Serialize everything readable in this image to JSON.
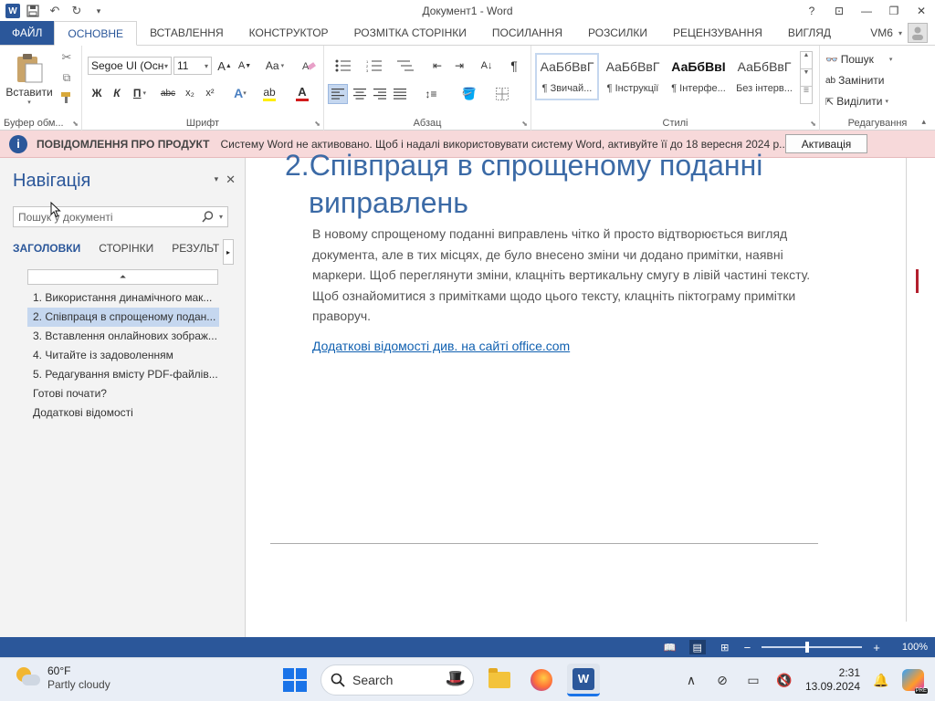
{
  "window": {
    "title": "Документ1 - Word",
    "help": "?",
    "controls": [
      "⊡",
      "—",
      "❐",
      "✕"
    ]
  },
  "quick_access": {
    "logo": "W",
    "icons": [
      "save-icon",
      "undo-icon",
      "redo-icon",
      "customize-icon"
    ]
  },
  "tabs": [
    "ФАЙЛ",
    "ОСНОВНЕ",
    "ВСТАВЛЕННЯ",
    "КОНСТРУКТОР",
    "РОЗМІТКА СТОРІНКИ",
    "ПОСИЛАННЯ",
    "РОЗСИЛКИ",
    "РЕЦЕНЗУВАННЯ",
    "ВИГЛЯД"
  ],
  "user": {
    "name": "VM6"
  },
  "ribbon": {
    "clipboard": {
      "paste_label": "Вставити",
      "group_label": "Буфер обм..."
    },
    "font": {
      "font_name": "Segoe UI (Осн",
      "font_size": "11",
      "grow": "A",
      "shrink": "A",
      "case": "Aa",
      "bold": "Ж",
      "italic": "К",
      "underline": "П",
      "strike": "abc",
      "subscript": "x₂",
      "superscript": "x²",
      "group_label": "Шрифт"
    },
    "paragraph": {
      "group_label": "Абзац",
      "pilcrow": "¶"
    },
    "styles": {
      "items": [
        {
          "sample": "АаБбВвГ",
          "name": "¶ Звичай..."
        },
        {
          "sample": "АаБбВвГ",
          "name": "¶ Інструкції"
        },
        {
          "sample": "АаБбВвІ",
          "name": "¶ Інтерфе..."
        },
        {
          "sample": "АаБбВвГ",
          "name": "Без інтерв..."
        }
      ],
      "group_label": "Стилі"
    },
    "editing": {
      "find": "Пошук",
      "replace": "Замінити",
      "select": "Виділити",
      "group_label": "Редагування"
    }
  },
  "notification": {
    "title": "ПОВІДОМЛЕННЯ ПРО ПРОДУКТ",
    "message": "Систему Word не активовано. Щоб і надалі використовувати систему Word, активуйте її до 18 вересня 2024 р..",
    "button": "Активація"
  },
  "navigation": {
    "title": "Навігація",
    "search_placeholder": "Пошук у документі",
    "tabs": [
      "ЗАГОЛОВКИ",
      "СТОРІНКИ",
      "РЕЗУЛЬТ"
    ],
    "headings": [
      "1. Використання динамічного мак...",
      "2. Співпраця в спрощеному подан...",
      "3. Вставлення онлайнових зображ...",
      "4. Читайте із задоволенням",
      "5. Редагування вмісту PDF-файлів...",
      "Готові почати?",
      "Додаткові відомості"
    ],
    "selected_index": 1
  },
  "document": {
    "heading_line1": "2.Співпраця в спрощеному поданні",
    "heading_line2": "виправлень",
    "body": "В новому спрощеному поданні виправлень чітко й просто відтворюється вигляд документа, але в тих місцях, де було внесено зміни чи додано примітки, наявні маркери. Щоб переглянути зміни, клацніть вертикальну смугу в лівій частині тексту. Щоб ознайомитися з примітками щодо цього тексту, клацніть піктограму примітки праворуч.",
    "link": "Додаткові відомості див. на сайті office.com"
  },
  "statusbar": {
    "zoom": "100%",
    "zoom_minus": "−",
    "zoom_plus": "+"
  },
  "taskbar": {
    "weather_temp": "60°F",
    "weather_desc": "Partly cloudy",
    "search_label": "Search",
    "time": "2:31",
    "date": "13.09.2024",
    "copilot_badge": "PRE"
  },
  "colors": {
    "word_blue": "#2b579a",
    "notification_bg": "#f7d9da",
    "heading_blue": "#3b6aa6",
    "selected_heading": "#c5d7ef"
  }
}
